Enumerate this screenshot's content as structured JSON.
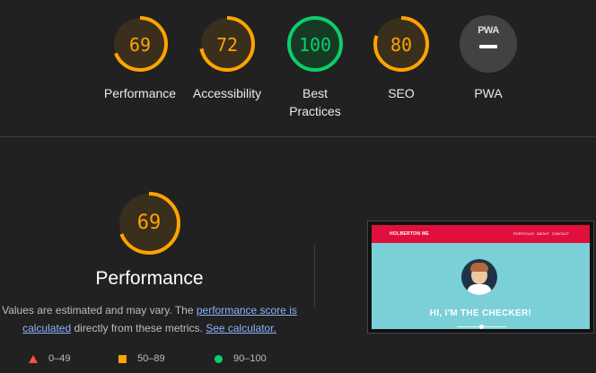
{
  "categories": [
    {
      "label": "Performance",
      "score": "69",
      "fraction": 0.69,
      "color": "#ffa400",
      "bg": "#3a2e1c"
    },
    {
      "label": "Accessibility",
      "score": "72",
      "fraction": 0.72,
      "color": "#ffa400",
      "bg": "#3a2e1c"
    },
    {
      "label": "Best Practices",
      "score": "100",
      "fraction": 1.0,
      "color": "#0cce6b",
      "bg": "#173a25"
    },
    {
      "label": "SEO",
      "score": "80",
      "fraction": 0.8,
      "color": "#ffa400",
      "bg": "#3a2e1c"
    }
  ],
  "pwa": {
    "label": "PWA",
    "badge": "PWA"
  },
  "performance": {
    "score": "69",
    "fraction": 0.69,
    "title": "Performance",
    "desc_text_1": "Values are estimated and may vary. The ",
    "desc_link_1": "performance score is calculated",
    "desc_text_2": " directly from these metrics. ",
    "desc_link_2": "See calculator."
  },
  "legend": [
    {
      "shape": "triangle",
      "range": "0–49",
      "color": "#ff4e42"
    },
    {
      "shape": "square",
      "range": "50–89",
      "color": "#ffa400"
    },
    {
      "shape": "circle",
      "range": "90–100",
      "color": "#0cce6b"
    }
  ],
  "screenshot": {
    "brand": "HOLBERTON ME",
    "menu": [
      "PORTFOLIO",
      "ABOUT",
      "CONTACT"
    ],
    "headline": "HI, I'M THE CHECKER!"
  }
}
